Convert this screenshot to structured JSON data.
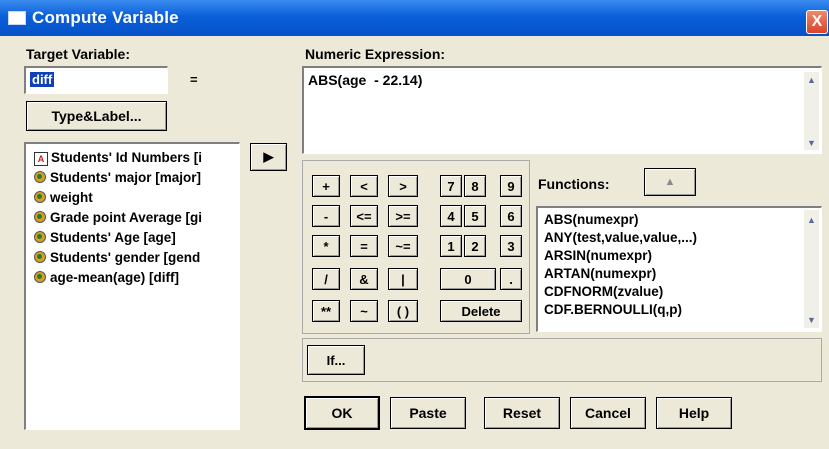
{
  "window": {
    "title": "Compute Variable",
    "close_glyph": "X"
  },
  "target": {
    "label": "Target Variable:",
    "value": "diff",
    "equals": "="
  },
  "type_label_button": "Type&Label...",
  "variables": [
    {
      "icon": "string",
      "label": "Students' Id Numbers [i"
    },
    {
      "icon": "numeric",
      "label": "Students' major [major]"
    },
    {
      "icon": "numeric",
      "label": "weight"
    },
    {
      "icon": "numeric",
      "label": "Grade point Average [gi"
    },
    {
      "icon": "numeric",
      "label": "Students' Age [age]"
    },
    {
      "icon": "numeric",
      "label": "Students' gender [gend"
    },
    {
      "icon": "numeric",
      "label": "age-mean(age) [diff]"
    }
  ],
  "move_button_glyph": "▶",
  "expression": {
    "label": "Numeric Expression:",
    "value": "ABS(age  - 22.14)"
  },
  "keypad": {
    "ops": [
      "+",
      "<",
      ">",
      "-",
      "<=",
      ">=",
      "*",
      "=",
      "~=",
      "/",
      "&",
      "|",
      "**",
      "~",
      "( )"
    ],
    "digits": [
      "7",
      "8",
      "9",
      "4",
      "5",
      "6",
      "1",
      "2",
      "3",
      "0",
      "."
    ],
    "delete": "Delete"
  },
  "functions": {
    "label": "Functions:",
    "items": [
      "ABS(numexpr)",
      "ANY(test,value,value,...)",
      "ARSIN(numexpr)",
      "ARTAN(numexpr)",
      "CDFNORM(zvalue)",
      "CDF.BERNOULLI(q,p)"
    ]
  },
  "if_button": "If...",
  "buttons": {
    "ok": "OK",
    "paste": "Paste",
    "reset": "Reset",
    "cancel": "Cancel",
    "help": "Help"
  }
}
